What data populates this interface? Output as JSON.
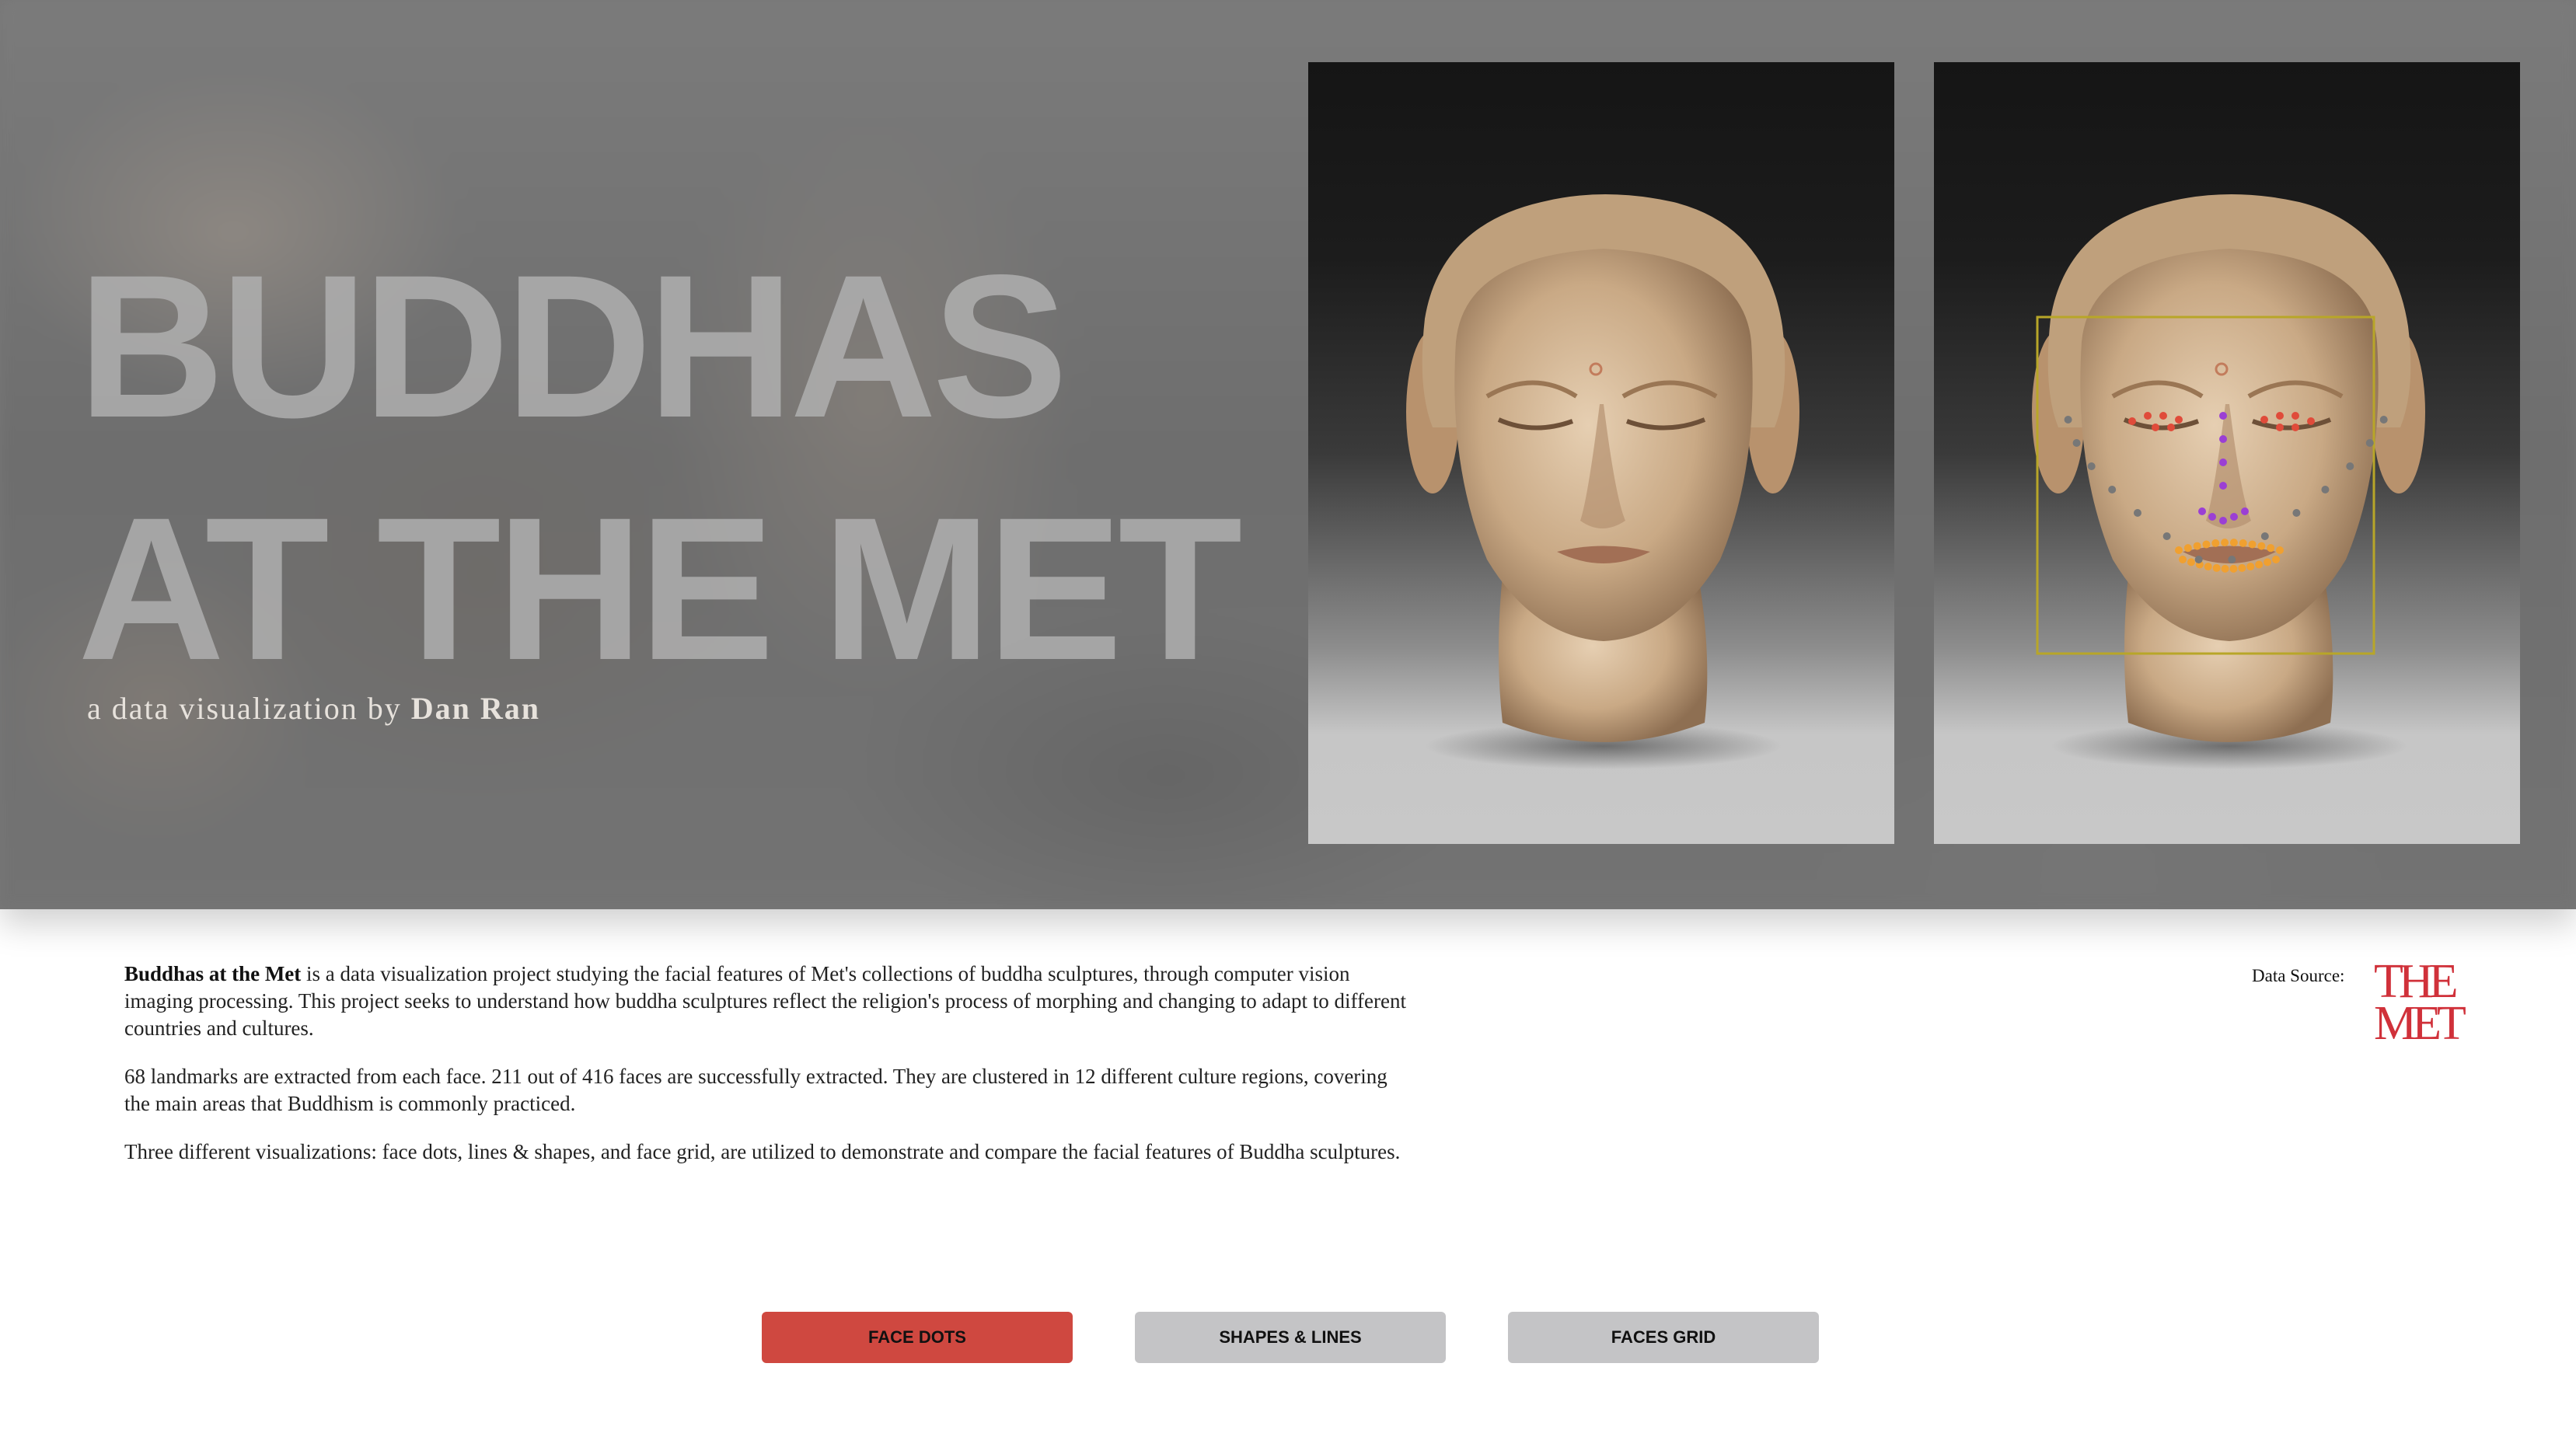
{
  "hero": {
    "title_line1": "BUDDHAS",
    "title_line2": "AT THE MET",
    "subtitle_prefix": "a data visualization by ",
    "subtitle_author": "Dan Ran"
  },
  "intro": {
    "project_name": "Buddhas at the Met",
    "paragraph1_rest": " is a data visualization project studying the facial features of Met's collections of buddha sculptures, through computer vision imaging processing. This project seeks to understand how buddha sculptures reflect the religion's process of morphing and changing to adapt to different countries and cultures.",
    "paragraph2": "68 landmarks are extracted from each face. 211 out of 416 faces are successfully extracted. They are clustered in 12 different culture regions, covering the main areas that Buddhism is commonly practiced.",
    "paragraph3": "Three different visualizations: face dots, lines & shapes, and face grid, are utilized to demonstrate and compare the facial features of Buddha sculptures."
  },
  "data_source": {
    "label": "Data Source:",
    "logo_line1": "THE",
    "logo_line2": "MET",
    "logo_color": "#d0313a"
  },
  "nav": {
    "buttons": [
      {
        "label": "FACE DOTS",
        "active": true
      },
      {
        "label": "SHAPES & LINES",
        "active": false
      },
      {
        "label": "FACES GRID",
        "active": false
      }
    ],
    "active_color": "#cf4840",
    "inactive_color": "#c4c4c6"
  },
  "landmark_colors": {
    "eyes": "#e04b3a",
    "nose": "#9b3fd4",
    "mouth": "#f0a030",
    "jaw": "#777777",
    "box": "#b8a628"
  }
}
